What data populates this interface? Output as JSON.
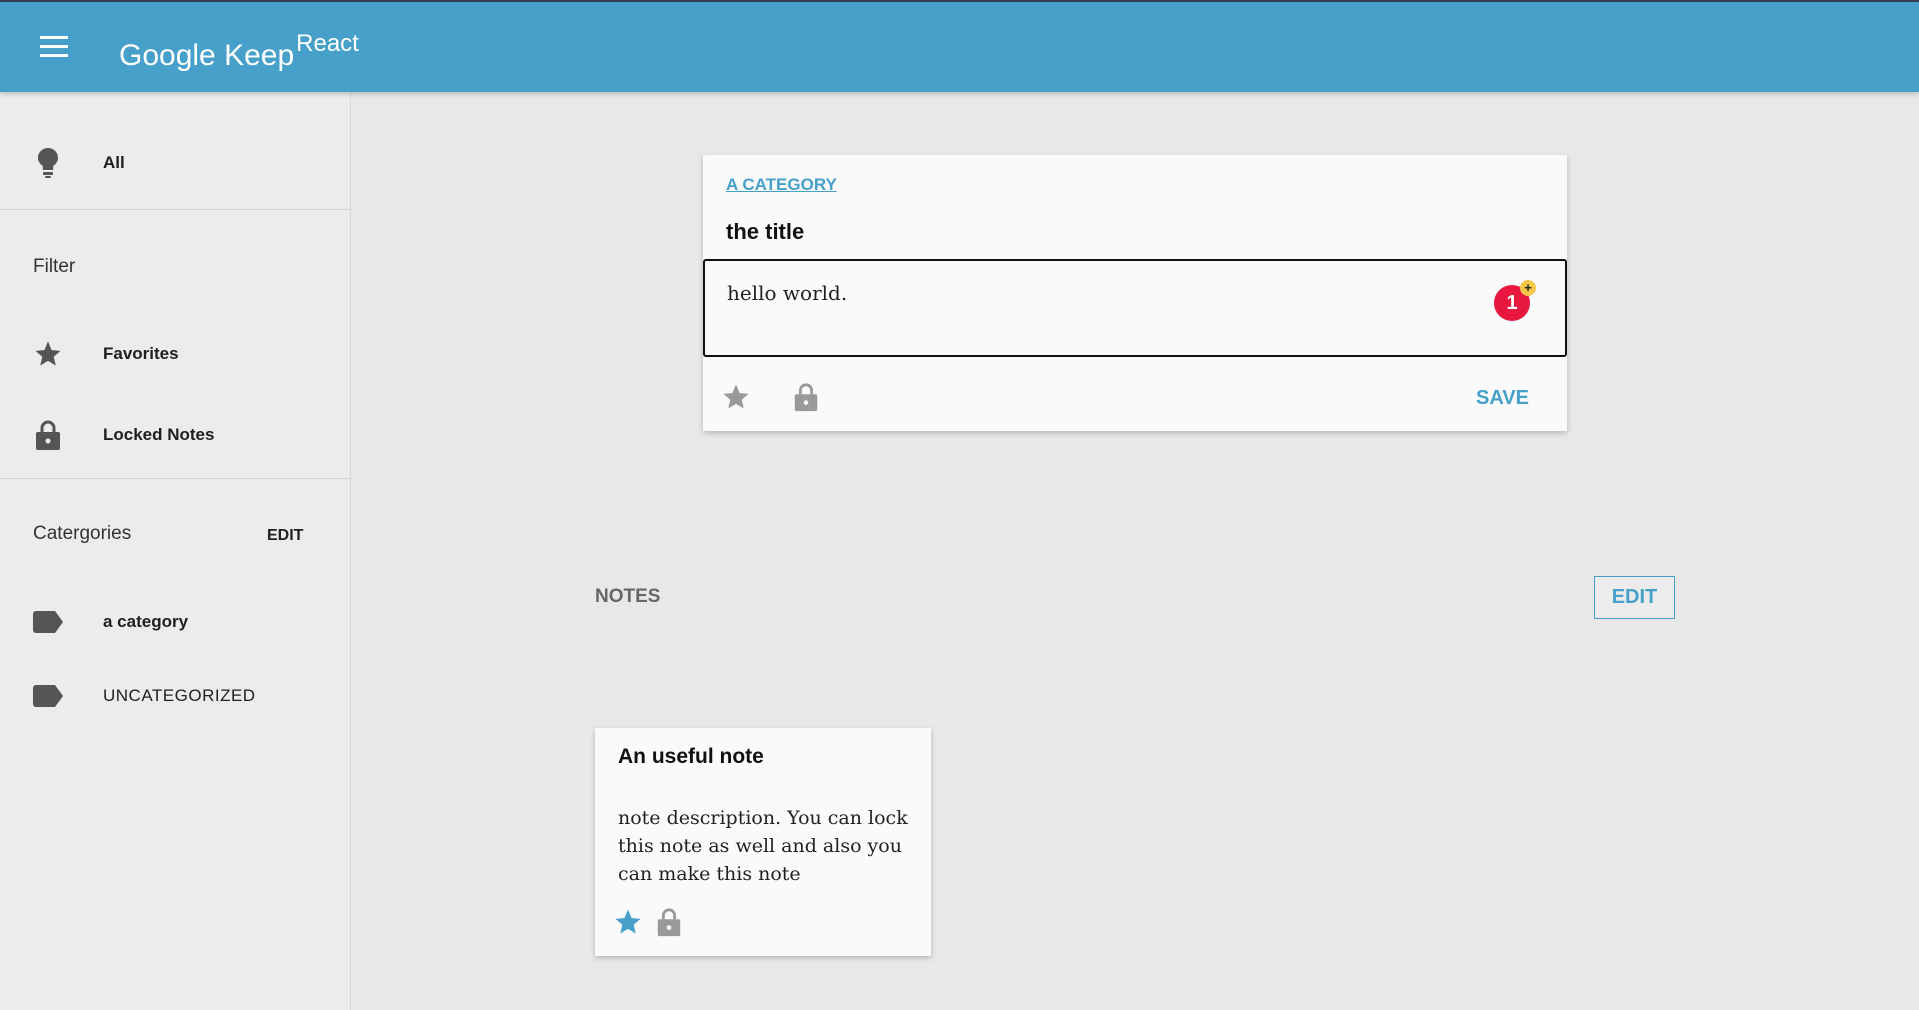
{
  "header": {
    "brand": "Google Keep",
    "brand_sup": "React",
    "color": "#47a0c9"
  },
  "sidebar": {
    "all_label": "All",
    "filter_heading": "Filter",
    "favorites_label": "Favorites",
    "locked_label": "Locked Notes",
    "categories_heading": "Catergories",
    "categories_edit": "EDIT",
    "categories": [
      {
        "label": "a category",
        "icon": "label-icon"
      },
      {
        "label": "UNCATEGORIZED",
        "icon": "label-icon"
      }
    ]
  },
  "editor": {
    "category": "A CATEGORY",
    "title": "the title",
    "body": "hello world.",
    "badge_count": "1",
    "badge_plus": "+",
    "save_label": "SAVE"
  },
  "notes": {
    "heading": "NOTES",
    "edit_label": "EDIT",
    "items": [
      {
        "title": "An useful note",
        "description": "note description. You can lock this note as well and also you can make this note",
        "favorite": true,
        "star_color": "#47a0c9"
      }
    ]
  }
}
